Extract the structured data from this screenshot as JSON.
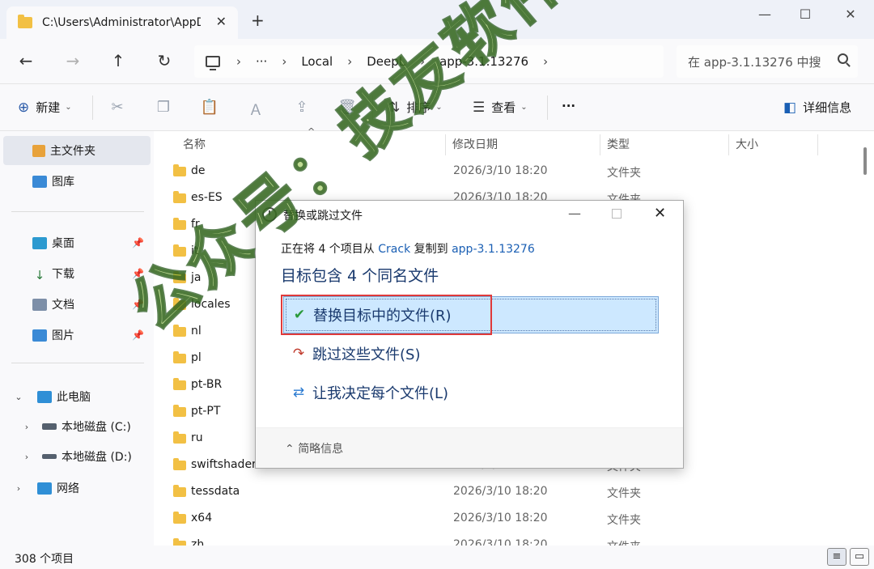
{
  "window": {
    "tab_title": "C:\\Users\\Administrator\\AppData",
    "tab_close": "✕",
    "tab_add": "+",
    "minimize": "—",
    "maximize": "☐",
    "close": "✕"
  },
  "nav": {
    "back": "←",
    "forward": "→",
    "up": "↑",
    "refresh": "↻",
    "more_crumbs": "···",
    "breadcrumbs": [
      "Local",
      "DeepL",
      "app-3.1.13276"
    ],
    "separator": "›",
    "search_placeholder": "在 app-3.1.13276 中搜"
  },
  "commands": {
    "new_label": "新建",
    "sort_label": "排序",
    "view_label": "查看",
    "more": "···",
    "details_label": "详细信息"
  },
  "sidebar": {
    "home": "主文件夹",
    "gallery": "图库",
    "desktop": "桌面",
    "downloads": "下载",
    "documents": "文档",
    "pictures": "图片",
    "this_pc": "此电脑",
    "drive_c": "本地磁盘 (C:)",
    "drive_d": "本地磁盘 (D:)",
    "network": "网络"
  },
  "columns": {
    "name": "名称",
    "date": "修改日期",
    "type": "类型",
    "size": "大小"
  },
  "files": [
    {
      "name": "de",
      "date": "2026/3/10 18:20",
      "type": "文件夹"
    },
    {
      "name": "es-ES",
      "date": "2026/3/10 18:20",
      "type": "文件夹"
    },
    {
      "name": "fr",
      "date": "",
      "type": ""
    },
    {
      "name": "it",
      "date": "",
      "type": ""
    },
    {
      "name": "ja",
      "date": "",
      "type": ""
    },
    {
      "name": "locales",
      "date": "",
      "type": ""
    },
    {
      "name": "nl",
      "date": "",
      "type": ""
    },
    {
      "name": "pl",
      "date": "",
      "type": ""
    },
    {
      "name": "pt-BR",
      "date": "",
      "type": ""
    },
    {
      "name": "pt-PT",
      "date": "",
      "type": ""
    },
    {
      "name": "ru",
      "date": "",
      "type": ""
    },
    {
      "name": "swiftshader",
      "date": "2026/3/10 18:20",
      "type": "文件夹"
    },
    {
      "name": "tessdata",
      "date": "2026/3/10 18:20",
      "type": "文件夹"
    },
    {
      "name": "x64",
      "date": "2026/3/10 18:20",
      "type": "文件夹"
    },
    {
      "name": "zh",
      "date": "2026/3/10 18:20",
      "type": "文件夹"
    }
  ],
  "status": {
    "count": "308 个项目"
  },
  "dialog": {
    "title": "替换或跳过文件",
    "desc_prefix": "正在将 4 个项目从 ",
    "desc_source": "Crack",
    "desc_middle": " 复制到 ",
    "desc_target": "app-3.1.13276",
    "heading": "目标包含 4 个同名文件",
    "option_replace": "替换目标中的文件(R)",
    "option_skip": "跳过这些文件(S)",
    "option_decide": "让我决定每个文件(L)",
    "more_info": "简略信息",
    "close": "✕"
  },
  "watermark": "公众号：技友软件管家",
  "colors": {
    "accent": "#1a5fb4",
    "folder": "#f2c044",
    "highlight": "#cde8ff",
    "red_box": "#e03a3a",
    "watermark": "#8cbe3c"
  }
}
